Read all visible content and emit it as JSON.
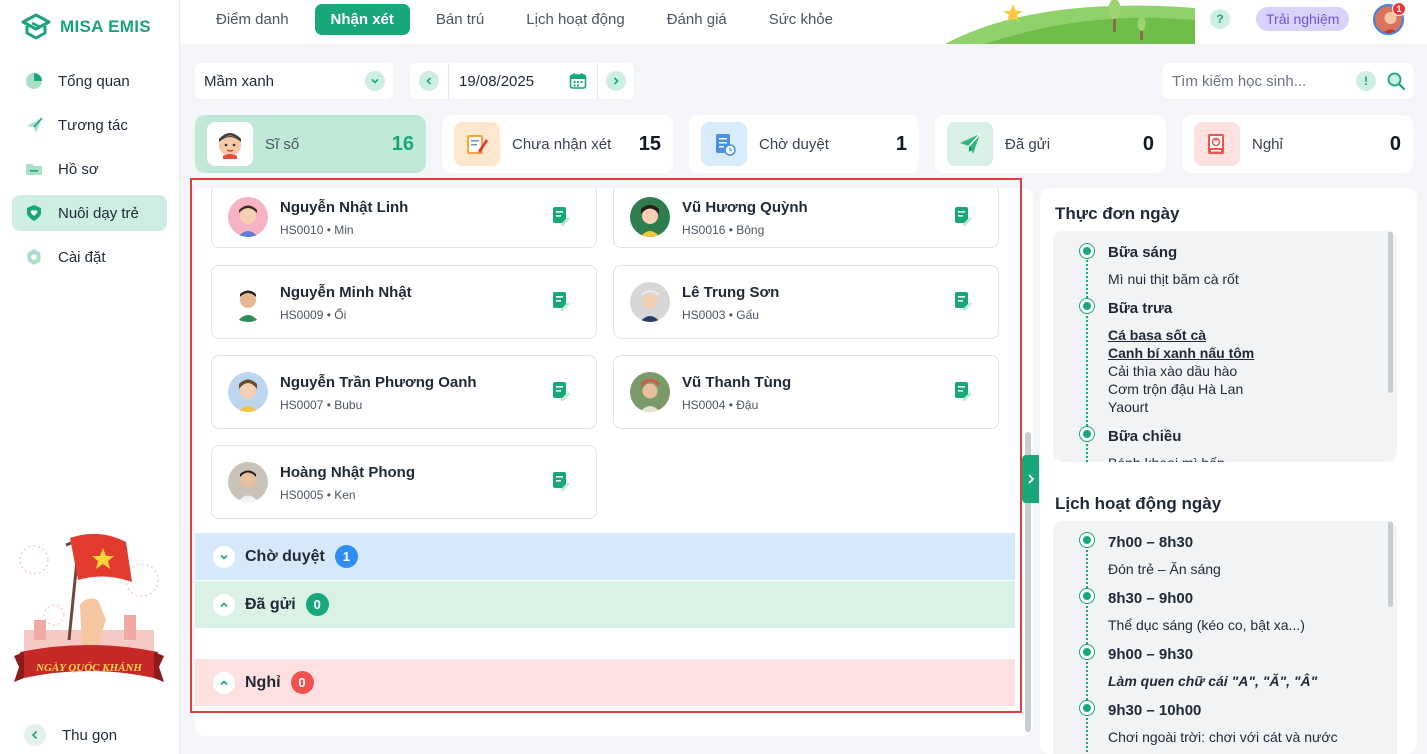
{
  "app": {
    "name": "MISA EMIS"
  },
  "sidebar": {
    "items": [
      {
        "label": "Tổng quan",
        "icon": "pie-chart-icon",
        "active": false
      },
      {
        "label": "Tương tác",
        "icon": "paper-plane-icon",
        "active": false
      },
      {
        "label": "Hồ sơ",
        "icon": "folder-icon",
        "active": false
      },
      {
        "label": "Nuôi dạy trẻ",
        "icon": "heart-shield-icon",
        "active": true
      },
      {
        "label": "Cài đặt",
        "icon": "gear-icon",
        "active": false
      }
    ],
    "banner_text": "NGÀY QUỐC KHÁNH",
    "collapse_label": "Thu gọn"
  },
  "topbar": {
    "tabs": [
      {
        "label": "Điểm danh",
        "active": false
      },
      {
        "label": "Nhận xét",
        "active": true
      },
      {
        "label": "Bán trú",
        "active": false
      },
      {
        "label": "Lịch hoạt động",
        "active": false
      },
      {
        "label": "Đánh giá",
        "active": false
      },
      {
        "label": "Sức khỏe",
        "active": false
      }
    ],
    "help_label": "?",
    "trial_label": "Trải nghiệm",
    "notification_count": "1"
  },
  "filters": {
    "class_name": "Mầm xanh",
    "date": "19/08/2025",
    "search_placeholder": "Tìm kiếm học sinh...",
    "search_value": ""
  },
  "stats": [
    {
      "label": "Sĩ số",
      "count": "16",
      "icon": "child-face-icon",
      "active": true
    },
    {
      "label": "Chưa nhận xét",
      "count": "15",
      "icon": "note-pencil-icon",
      "active": false
    },
    {
      "label": "Chờ duyệt",
      "count": "1",
      "icon": "document-clock-icon",
      "active": false
    },
    {
      "label": "Đã gửi",
      "count": "0",
      "icon": "send-icon",
      "active": false
    },
    {
      "label": "Nghỉ",
      "count": "0",
      "icon": "absent-icon",
      "active": false
    }
  ],
  "students": [
    {
      "name": "Nguyễn Nhật Linh",
      "code": "HS0010 • Min"
    },
    {
      "name": "Vũ Hương Quỳnh",
      "code": "HS0016 • Bông"
    },
    {
      "name": "Nguyễn Minh Nhật",
      "code": "HS0009 • Ổi"
    },
    {
      "name": "Lê Trung Sơn",
      "code": "HS0003 • Gấu"
    },
    {
      "name": "Nguyễn Trần Phương Oanh",
      "code": "HS0007 • Bubu"
    },
    {
      "name": "Vũ Thanh Tùng",
      "code": "HS0004 • Đậu"
    },
    {
      "name": "Hoàng Nhật Phong",
      "code": "HS0005 • Ken"
    }
  ],
  "sections": [
    {
      "title": "Chờ duyệt",
      "count": "1"
    },
    {
      "title": "Đã gửi",
      "count": "0"
    },
    {
      "title": "Nghỉ",
      "count": "0"
    }
  ],
  "menu": {
    "title": "Thực đơn ngày",
    "meals": [
      {
        "name": "Bữa sáng",
        "items": [
          "Mì nui thịt băm cà rốt"
        ]
      },
      {
        "name": "Bữa trưa",
        "items": [
          "Cá basa sốt cà",
          "Canh bí xanh nấu tôm",
          "Cải thìa xào dầu hào",
          "Cơm trộn đậu Hà Lan",
          "Yaourt"
        ]
      },
      {
        "name": "Bữa chiều",
        "items": [
          "Bánh khoai mì hấp"
        ]
      }
    ]
  },
  "schedule": {
    "title": "Lịch hoạt động ngày",
    "items": [
      {
        "time": "7h00 – 8h30",
        "activity": "Đón trẻ – Ăn sáng"
      },
      {
        "time": "8h30 – 9h00",
        "activity": "Thể dục sáng (kéo co, bật xa...)"
      },
      {
        "time": "9h00 – 9h30",
        "activity": "Làm quen chữ cái \"A\", \"Ă\", \"Â\""
      },
      {
        "time": "9h30 – 10h00",
        "activity": "Chơi ngoài trời: chơi với cát và nước"
      }
    ]
  }
}
